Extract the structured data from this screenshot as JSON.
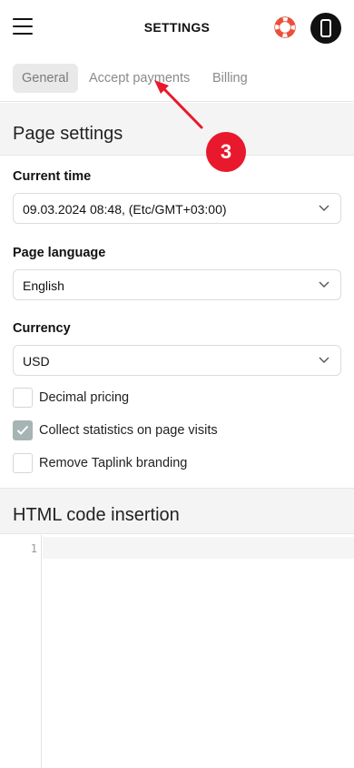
{
  "header": {
    "title": "SETTINGS",
    "menu_icon": "hamburger-menu-icon",
    "help_icon": "lifebuoy-icon",
    "device_icon": "mobile-phone-icon"
  },
  "tabs": [
    {
      "label": "General",
      "active": true
    },
    {
      "label": "Accept payments",
      "active": false
    },
    {
      "label": "Billing",
      "active": false
    }
  ],
  "page_settings": {
    "heading": "Page settings",
    "current_time": {
      "label": "Current time",
      "value": "09.03.2024 08:48, (Etc/GMT+03:00)"
    },
    "page_language": {
      "label": "Page language",
      "value": "English"
    },
    "currency": {
      "label": "Currency",
      "value": "USD"
    },
    "checkboxes": [
      {
        "label": "Decimal pricing",
        "checked": false
      },
      {
        "label": "Collect statistics on page visits",
        "checked": true
      },
      {
        "label": "Remove Taplink branding",
        "checked": false
      }
    ]
  },
  "html_code": {
    "heading": "HTML code insertion",
    "line_numbers": [
      "1"
    ]
  },
  "annotation": {
    "badge": "3",
    "color": "#e8192c"
  },
  "colors": {
    "checkbox_checked": "#a7b4b4",
    "section_bg": "#f4f4f4"
  }
}
